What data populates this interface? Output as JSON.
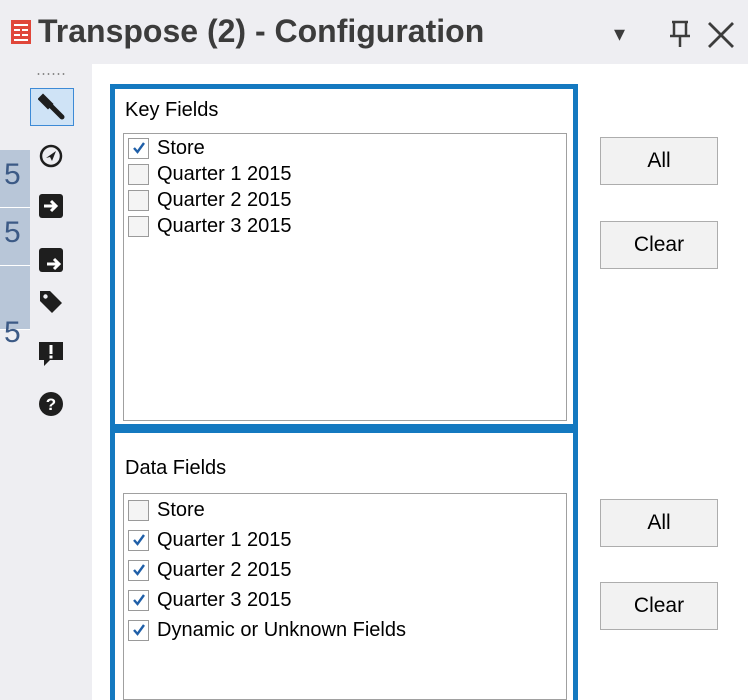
{
  "window": {
    "title": "Transpose (2) - Configuration",
    "app_icon": "transpose-tool-icon",
    "dropdown_glyph": "▾",
    "pin_glyph": "⊓",
    "close_glyph": "✕"
  },
  "toolbar": {
    "items": [
      {
        "name": "wrench-icon",
        "selected": true
      },
      {
        "name": "navigate-icon",
        "selected": false
      },
      {
        "name": "input-arrow-icon",
        "selected": false
      },
      {
        "name": "output-arrow-icon",
        "selected": false
      },
      {
        "name": "tag-icon",
        "selected": false
      },
      {
        "name": "comment-alert-icon",
        "selected": false
      },
      {
        "name": "help-icon",
        "selected": false
      }
    ]
  },
  "canvas": {
    "tab_glyphs": [
      "5",
      "5",
      "5"
    ]
  },
  "key_fields": {
    "label": "Key Fields",
    "items": [
      {
        "label": "Store",
        "checked": true
      },
      {
        "label": "Quarter 1 2015",
        "checked": false
      },
      {
        "label": "Quarter 2 2015",
        "checked": false
      },
      {
        "label": "Quarter 3 2015",
        "checked": false
      }
    ],
    "all_label": "All",
    "clear_label": "Clear"
  },
  "data_fields": {
    "label": "Data Fields",
    "items": [
      {
        "label": "Store",
        "checked": false
      },
      {
        "label": "Quarter 1 2015",
        "checked": true
      },
      {
        "label": "Quarter 2 2015",
        "checked": true
      },
      {
        "label": "Quarter 3 2015",
        "checked": true
      },
      {
        "label": "Dynamic or Unknown Fields",
        "checked": true
      }
    ],
    "all_label": "All",
    "clear_label": "Clear"
  },
  "colors": {
    "highlight_border": "#1479c0",
    "check": "#1f5fa8"
  }
}
